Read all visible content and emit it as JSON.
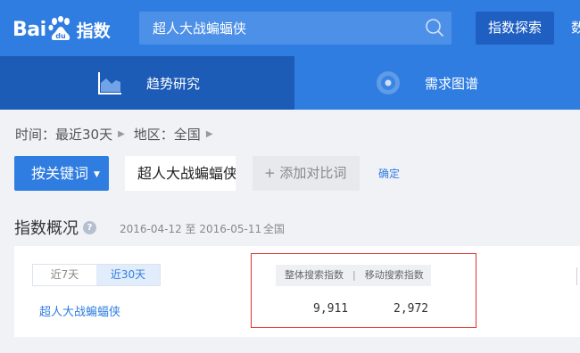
{
  "header": {
    "logo_text_a": "Bai",
    "logo_text_b": "du",
    "logo_suffix": "指数",
    "search_value": "超人大战蝙蝠侠",
    "explore_label": "指数探索",
    "more_label": "数"
  },
  "nav": {
    "tabs": [
      {
        "label": "趋势研究",
        "active": true
      },
      {
        "label": "需求图谱",
        "active": false
      }
    ]
  },
  "filters": {
    "time_label": "时间：最近30天",
    "region_label": "地区：全国"
  },
  "keywords": {
    "button_label": "按关键词",
    "current_keyword": "超人大战蝙蝠侠",
    "add_compare_label": "+ 添加对比词",
    "confirm_label": "确定"
  },
  "overview": {
    "title": "指数概况",
    "help_icon": "?",
    "date_range": "2016-04-12 至 2016-05-11",
    "region": "全国",
    "range_options": [
      "近7天",
      "近30天"
    ],
    "selected_range": "近30天",
    "keyword": "超人大战蝙蝠侠",
    "metric_headers": [
      "整体搜索指数",
      "|",
      "移动搜索指数"
    ],
    "total_index": "9,911",
    "mobile_index": "2,972"
  },
  "colors": {
    "brand_blue": "#2f7de1",
    "active_tab": "#1c5bb6",
    "highlight_red": "#e0312b"
  }
}
